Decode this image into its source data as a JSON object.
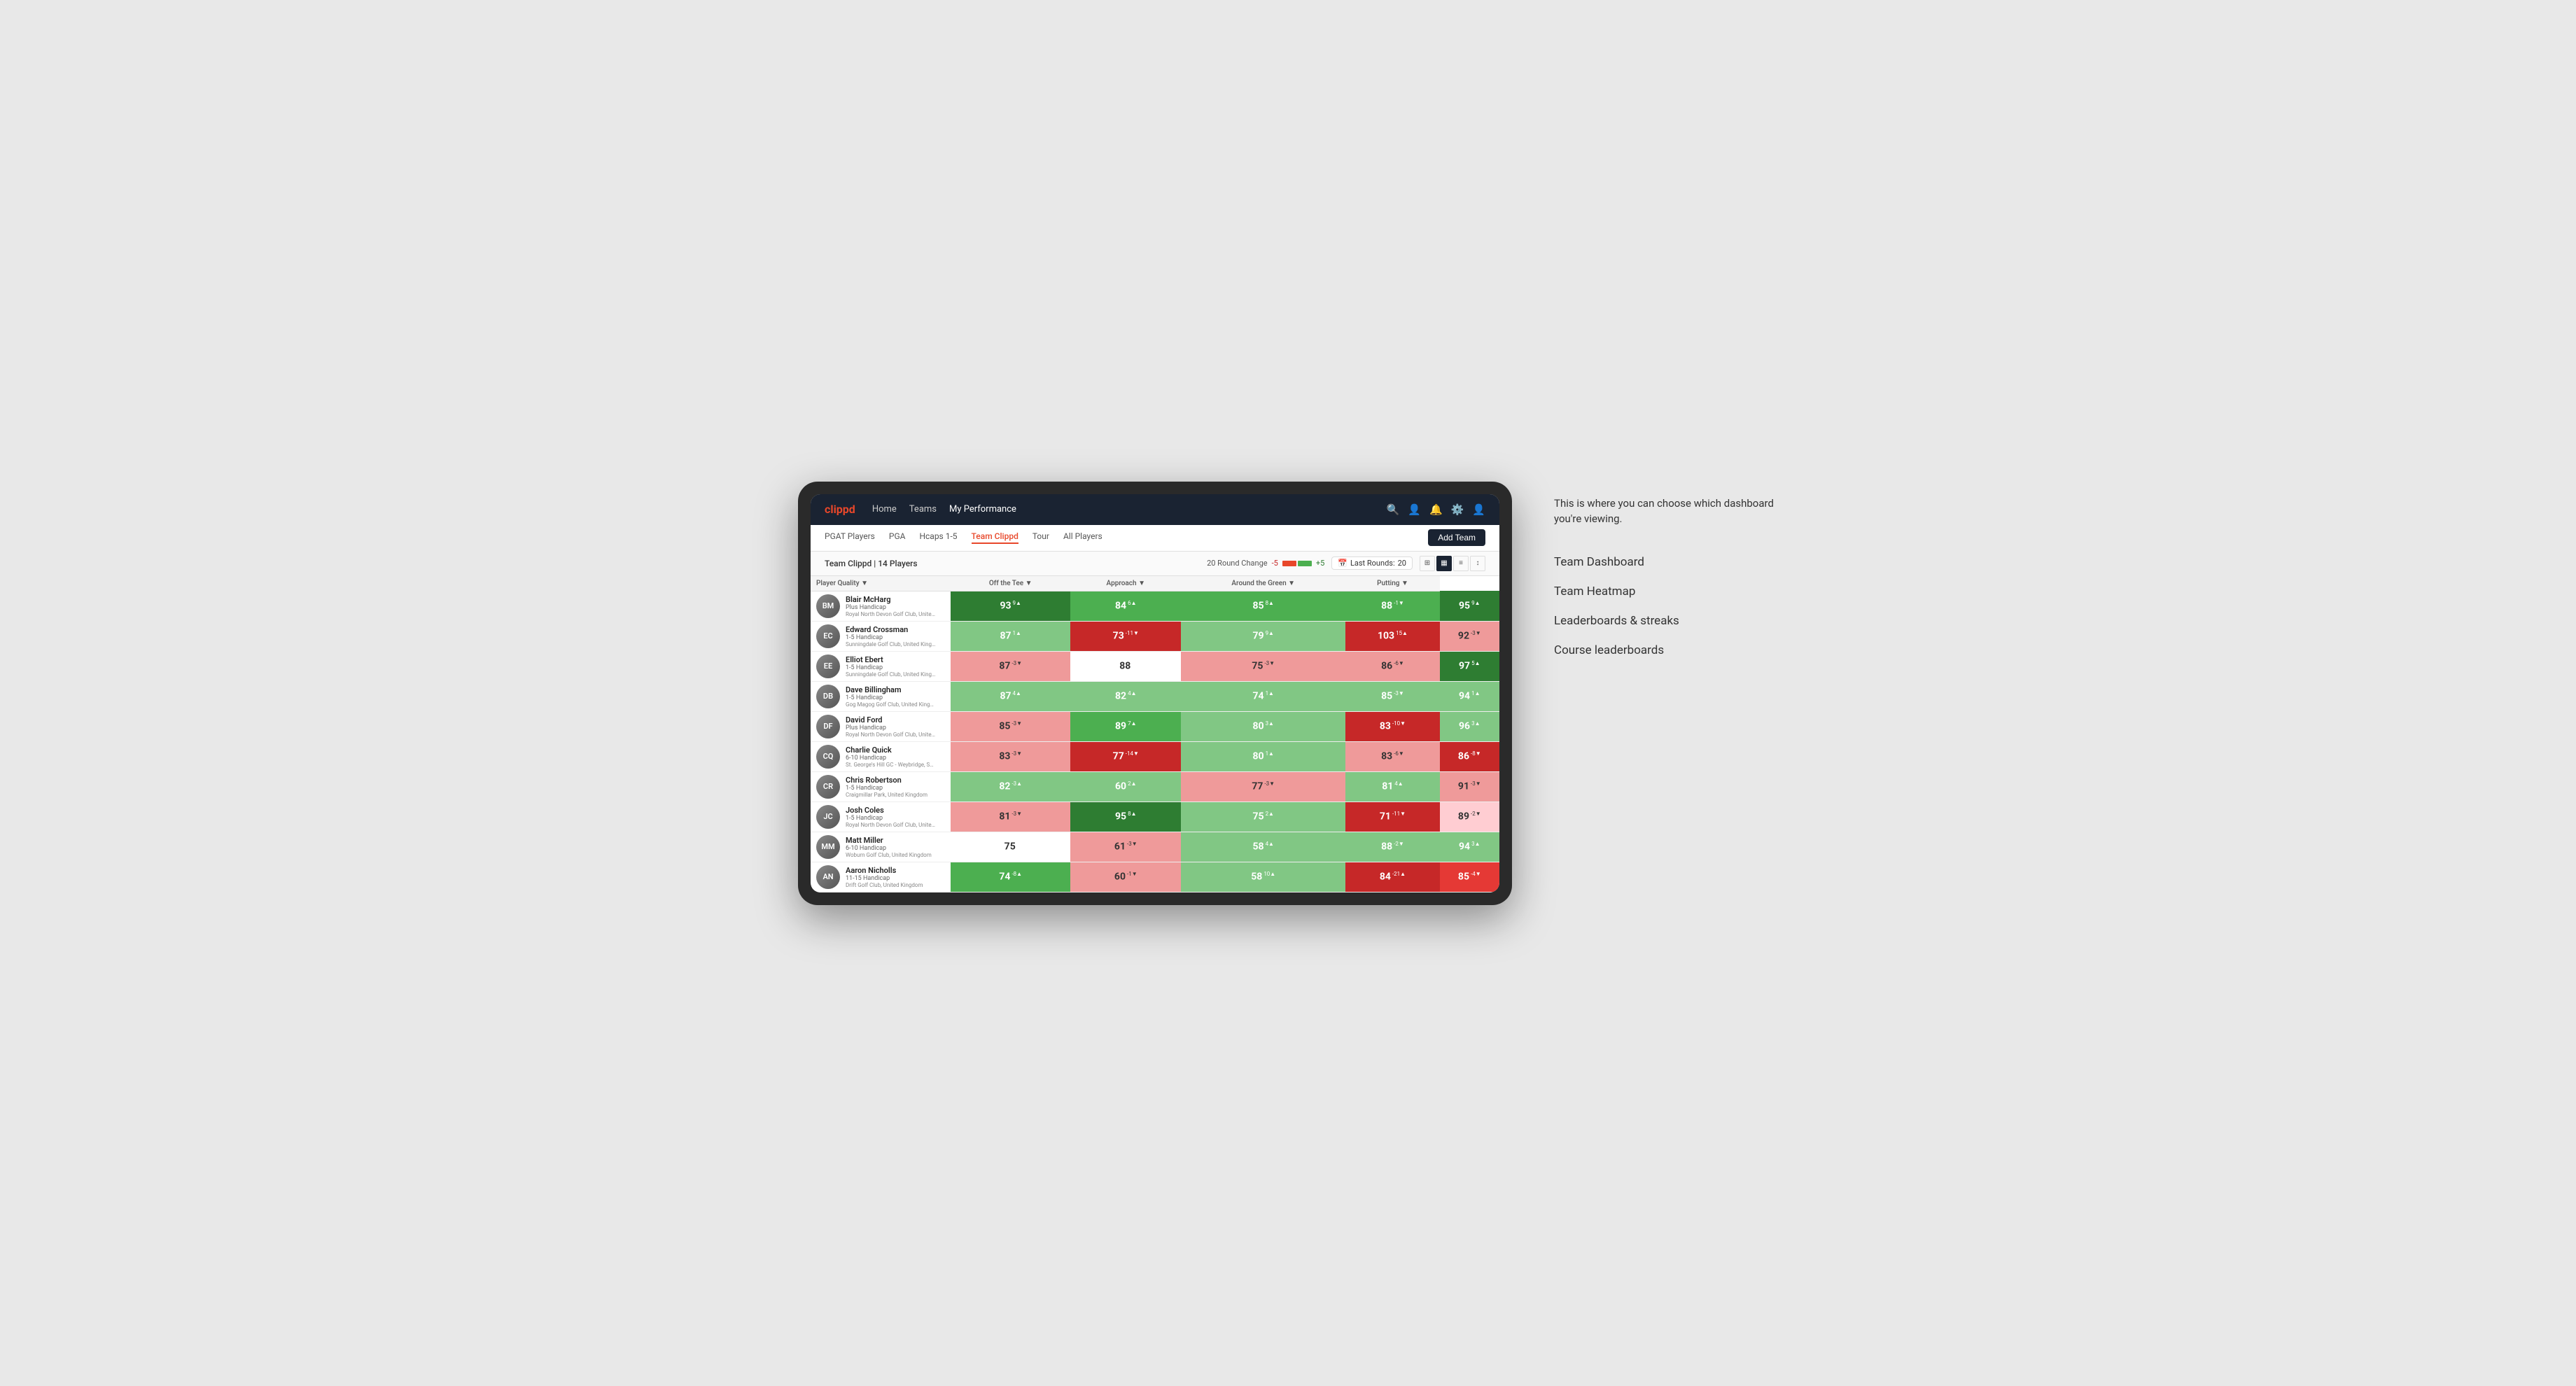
{
  "annotation": {
    "callout": "This is where you can choose which dashboard you're viewing.",
    "items": [
      "Team Dashboard",
      "Team Heatmap",
      "Leaderboards & streaks",
      "Course leaderboards"
    ]
  },
  "nav": {
    "logo": "clippd",
    "links": [
      "Home",
      "Teams",
      "My Performance"
    ],
    "active_link": "My Performance"
  },
  "sub_nav": {
    "links": [
      "PGAT Players",
      "PGA",
      "Hcaps 1-5",
      "Team Clippd",
      "Tour",
      "All Players"
    ],
    "active": "Team Clippd",
    "add_team_label": "Add Team"
  },
  "team_header": {
    "name": "Team Clippd | 14 Players",
    "round_change_label": "20 Round Change",
    "round_change_neg": "-5",
    "round_change_pos": "+5",
    "last_rounds_label": "Last Rounds:",
    "last_rounds_value": "20"
  },
  "table": {
    "columns": [
      "Player Quality ▼",
      "Off the Tee ▼",
      "Approach ▼",
      "Around the Green ▼",
      "Putting ▼"
    ],
    "rows": [
      {
        "name": "Blair McHarg",
        "hcap": "Plus Handicap",
        "club": "Royal North Devon Golf Club, United Kingdom",
        "initials": "BM",
        "stats": [
          {
            "value": "93",
            "change": "9▲",
            "color": "green-dark"
          },
          {
            "value": "84",
            "change": "6▲",
            "color": "green-med"
          },
          {
            "value": "85",
            "change": "8▲",
            "color": "green-med"
          },
          {
            "value": "88",
            "change": "-1▼",
            "color": "green-med"
          },
          {
            "value": "95",
            "change": "9▲",
            "color": "green-dark"
          }
        ]
      },
      {
        "name": "Edward Crossman",
        "hcap": "1-5 Handicap",
        "club": "Sunningdale Golf Club, United Kingdom",
        "initials": "EC",
        "stats": [
          {
            "value": "87",
            "change": "1▲",
            "color": "green-light"
          },
          {
            "value": "73",
            "change": "-11▼",
            "color": "red-dark"
          },
          {
            "value": "79",
            "change": "9▲",
            "color": "green-light"
          },
          {
            "value": "103",
            "change": "15▲",
            "color": "red-dark"
          },
          {
            "value": "92",
            "change": "-3▼",
            "color": "red-light"
          }
        ]
      },
      {
        "name": "Elliot Ebert",
        "hcap": "1-5 Handicap",
        "club": "Sunningdale Golf Club, United Kingdom",
        "initials": "EE",
        "stats": [
          {
            "value": "87",
            "change": "-3▼",
            "color": "red-light"
          },
          {
            "value": "88",
            "change": "",
            "color": "neutral"
          },
          {
            "value": "75",
            "change": "-3▼",
            "color": "red-light"
          },
          {
            "value": "86",
            "change": "-6▼",
            "color": "red-light"
          },
          {
            "value": "97",
            "change": "5▲",
            "color": "green-dark"
          }
        ]
      },
      {
        "name": "Dave Billingham",
        "hcap": "1-5 Handicap",
        "club": "Gog Magog Golf Club, United Kingdom",
        "initials": "DB",
        "stats": [
          {
            "value": "87",
            "change": "4▲",
            "color": "green-light"
          },
          {
            "value": "82",
            "change": "4▲",
            "color": "green-light"
          },
          {
            "value": "74",
            "change": "1▲",
            "color": "green-light"
          },
          {
            "value": "85",
            "change": "-3▼",
            "color": "green-light"
          },
          {
            "value": "94",
            "change": "1▲",
            "color": "green-light"
          }
        ]
      },
      {
        "name": "David Ford",
        "hcap": "Plus Handicap",
        "club": "Royal North Devon Golf Club, United Kingdom",
        "initials": "DF",
        "stats": [
          {
            "value": "85",
            "change": "-3▼",
            "color": "red-light"
          },
          {
            "value": "89",
            "change": "7▲",
            "color": "green-med"
          },
          {
            "value": "80",
            "change": "3▲",
            "color": "green-light"
          },
          {
            "value": "83",
            "change": "-10▼",
            "color": "red-dark"
          },
          {
            "value": "96",
            "change": "3▲",
            "color": "green-light"
          }
        ]
      },
      {
        "name": "Charlie Quick",
        "hcap": "6-10 Handicap",
        "club": "St. George's Hill GC - Weybridge, Surrey, United Kingdom",
        "initials": "CQ",
        "stats": [
          {
            "value": "83",
            "change": "-3▼",
            "color": "red-light"
          },
          {
            "value": "77",
            "change": "-14▼",
            "color": "red-dark"
          },
          {
            "value": "80",
            "change": "1▲",
            "color": "green-light"
          },
          {
            "value": "83",
            "change": "-6▼",
            "color": "red-light"
          },
          {
            "value": "86",
            "change": "-8▼",
            "color": "red-dark"
          }
        ]
      },
      {
        "name": "Chris Robertson",
        "hcap": "1-5 Handicap",
        "club": "Craigmillar Park, United Kingdom",
        "initials": "CR",
        "stats": [
          {
            "value": "82",
            "change": "-3▲",
            "color": "green-light"
          },
          {
            "value": "60",
            "change": "2▲",
            "color": "green-light"
          },
          {
            "value": "77",
            "change": "-3▼",
            "color": "red-light"
          },
          {
            "value": "81",
            "change": "4▲",
            "color": "green-light"
          },
          {
            "value": "91",
            "change": "-3▼",
            "color": "red-light"
          }
        ]
      },
      {
        "name": "Josh Coles",
        "hcap": "1-5 Handicap",
        "club": "Royal North Devon Golf Club, United Kingdom",
        "initials": "JC",
        "stats": [
          {
            "value": "81",
            "change": "-3▼",
            "color": "red-light"
          },
          {
            "value": "95",
            "change": "8▲",
            "color": "green-dark"
          },
          {
            "value": "75",
            "change": "2▲",
            "color": "green-light"
          },
          {
            "value": "71",
            "change": "-11▼",
            "color": "red-dark"
          },
          {
            "value": "89",
            "change": "-2▼",
            "color": "pink-light"
          }
        ]
      },
      {
        "name": "Matt Miller",
        "hcap": "6-10 Handicap",
        "club": "Woburn Golf Club, United Kingdom",
        "initials": "MM",
        "stats": [
          {
            "value": "75",
            "change": "",
            "color": "neutral"
          },
          {
            "value": "61",
            "change": "-3▼",
            "color": "red-light"
          },
          {
            "value": "58",
            "change": "4▲",
            "color": "green-light"
          },
          {
            "value": "88",
            "change": "-2▼",
            "color": "green-light"
          },
          {
            "value": "94",
            "change": "3▲",
            "color": "green-light"
          }
        ]
      },
      {
        "name": "Aaron Nicholls",
        "hcap": "11-15 Handicap",
        "club": "Drift Golf Club, United Kingdom",
        "initials": "AN",
        "stats": [
          {
            "value": "74",
            "change": "-8▲",
            "color": "green-med"
          },
          {
            "value": "60",
            "change": "-1▼",
            "color": "red-light"
          },
          {
            "value": "58",
            "change": "10▲",
            "color": "green-light"
          },
          {
            "value": "84",
            "change": "-21▲",
            "color": "red-dark"
          },
          {
            "value": "85",
            "change": "-4▼",
            "color": "red-med"
          }
        ]
      }
    ]
  }
}
